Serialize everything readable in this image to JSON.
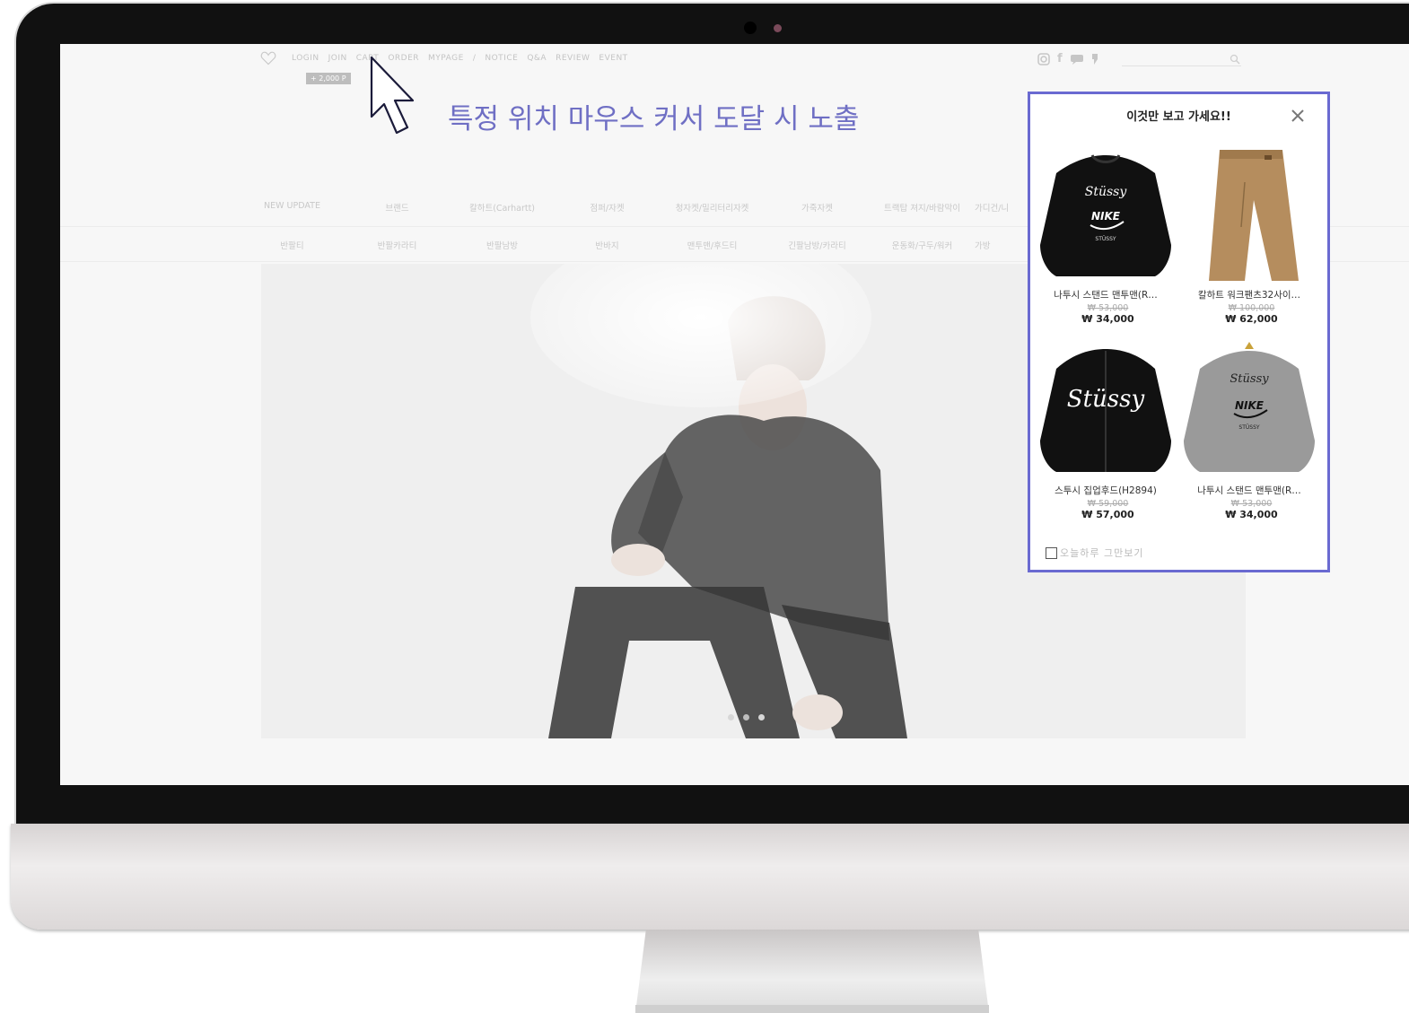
{
  "annotation": "특정 위치 마우스 커서 도달 시 노출",
  "top_bar": {
    "links": [
      "LOGIN",
      "JOIN",
      "CART",
      "ORDER",
      "MYPAGE",
      "/",
      "NOTICE",
      "Q&A",
      "REVIEW",
      "EVENT"
    ],
    "point_badge": "+ 2,000 P",
    "social_icons": [
      "instagram-icon",
      "facebook-icon",
      "kakaotalk-icon",
      "blog-icon"
    ]
  },
  "nav": {
    "row1": [
      "NEW UPDATE",
      "브랜드",
      "칼하트(Carhartt)",
      "점퍼/자켓",
      "청자켓/밀리터리자켓",
      "가죽자켓",
      "트랙탑 져지/바람막이",
      "가디건/니"
    ],
    "row2": [
      "반팔티",
      "반팔카라티",
      "반팔남방",
      "반바지",
      "맨투맨/후드티",
      "긴팔남방/카라티",
      "운동화/구두/워커",
      "가방"
    ]
  },
  "hero": {
    "slides": 3,
    "active_slide": 2
  },
  "popup": {
    "title": "이것만 보고 가세요!!",
    "products": [
      {
        "name": "나투시 스탠드 맨투맨(R…",
        "original_price": "₩ 53,000",
        "price": "₩ 34,000",
        "image": "black-sweatshirt-nike-graphic"
      },
      {
        "name": "칼하트 워크팬츠32사이…",
        "original_price": "₩ 100,000",
        "price": "₩ 62,000",
        "image": "tan-work-pants"
      },
      {
        "name": "스투시 집업후드(H2894)",
        "original_price": "₩ 59,000",
        "price": "₩ 57,000",
        "image": "black-zip-hoodie"
      },
      {
        "name": "나투시 스탠드 맨투맨(R…",
        "original_price": "₩ 53,000",
        "price": "₩ 34,000",
        "image": "grey-sweatshirt-nike-graphic"
      }
    ],
    "hide_today_label": "오늘하루 그만보기"
  },
  "colors": {
    "popup_border": "#6a6ad1",
    "annotation": "#6f6fc4"
  }
}
